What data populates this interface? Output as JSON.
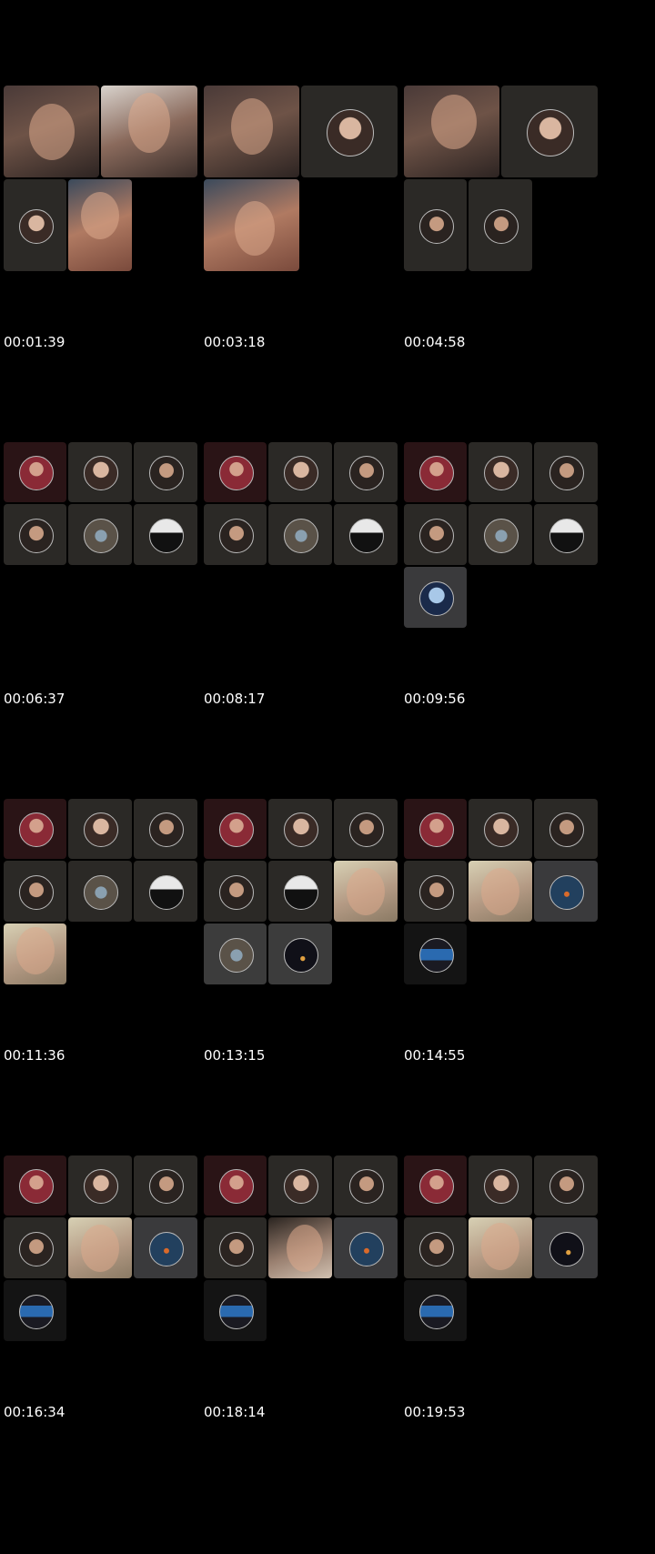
{
  "timestamps": [
    "00:01:39",
    "00:03:18",
    "00:04:58",
    "00:06:37",
    "00:08:17",
    "00:09:56",
    "00:11:36",
    "00:13:15",
    "00:14:55",
    "00:16:34",
    "00:18:14",
    "00:19:53"
  ],
  "colors": {
    "background": "#000000",
    "tile": "#2b2926",
    "text": "#ffffff"
  }
}
